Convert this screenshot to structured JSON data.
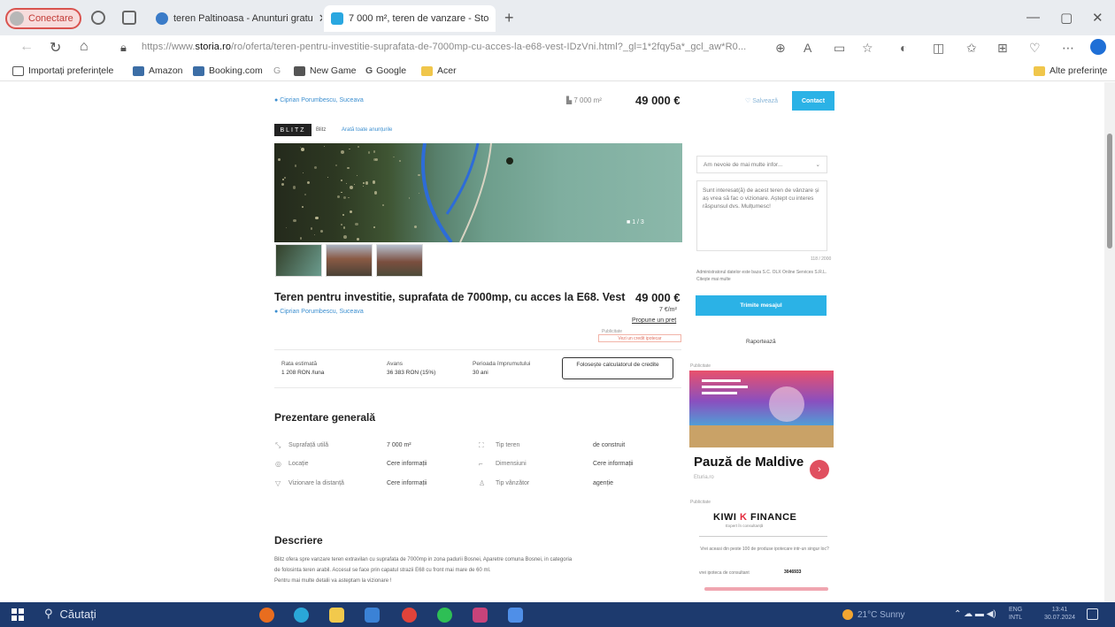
{
  "browser": {
    "profile_label": "Conectare",
    "tabs": [
      {
        "title": "teren Paltinoasa - Anunturi gratu",
        "active": false
      },
      {
        "title": "7 000 m², teren de vanzare - Sto",
        "active": true
      }
    ],
    "url_prefix": "https://www.",
    "url_domain": "storia.ro",
    "url_path": "/ro/oferta/teren-pentru-investitie-suprafata-de-7000mp-cu-acces-la-e68-vest-IDzVni.html?_gl=1*2fqy5a*_gcl_aw*R0...",
    "bookmarks": [
      "Importați preferințele",
      "Amazon",
      "Booking.com",
      "G",
      "New Game",
      "Google",
      "Acer"
    ],
    "other_bookmarks": "Alte preferințe"
  },
  "sticky": {
    "location": "Ciprian Porumbescu, Suceava",
    "area": "7 000 m²",
    "price": "49 000 €",
    "save": "Salvează",
    "contact": "Contact"
  },
  "agency": {
    "logo": "BLITZ",
    "name": "Blitz",
    "link": "Arată toate anunțurile"
  },
  "gallery": {
    "counter": "1 / 3"
  },
  "listing": {
    "title": "Teren pentru investitie, suprafata de 7000mp, cu acces la E68. Vest",
    "location": "Ciprian Porumbescu, Suceava",
    "price": "49 000 €",
    "price_per_m2": "7 €/m²",
    "propose": "Propune un preț",
    "publicity": "Publicitate",
    "developer_badge": "Vezi un credit ipotecar"
  },
  "credit": {
    "items": [
      {
        "label": "Rata estimată",
        "value": "1 208 RON /luna"
      },
      {
        "label": "Avans",
        "value": "36 383 RON (15%)"
      },
      {
        "label": "Perioada împrumutului",
        "value": "30 ani"
      }
    ],
    "calc_button": "Folosește calculatorul de credite"
  },
  "overview": {
    "title": "Prezentare generală",
    "rows": [
      {
        "label": "Suprafață utilă",
        "value": "7 000 m²",
        "label2": "Tip teren",
        "value2": "de construit"
      },
      {
        "label": "Locație",
        "value": "Cere informații",
        "label2": "Dimensiuni",
        "value2": "Cere informații"
      },
      {
        "label": "Vizionare la distanță",
        "value": "Cere informații",
        "label2": "Tip vânzător",
        "value2": "agenție"
      }
    ]
  },
  "description": {
    "title": "Descriere",
    "lines": [
      "Blitz ofera spre vanzare teren extravilan cu suprafata de 7000mp in zona padurii Bosnei, Aparetre comuna Bosnei, in categoria",
      "de folosinta teren arabil. Accesul se face prin capatul strazii E68 cu front mai mare de 60 ml.",
      "Pentru mai multe detalii va asteptam la vizionare !"
    ]
  },
  "contact_form": {
    "subject": "Am nevoie de mai multe infor...",
    "message": "Sunt interesat(ă) de acest teren de vânzare și aș vrea să fac o vizionare. Aștept cu interes răspunsul dvs. Mulțumesc!",
    "char_count": "118 / 2000",
    "consent": "Administratorul datelor este baza S.C. OLX Online Services S.R.L. Citește mai multe",
    "send_button": "Trimite mesajul",
    "report": "Raportează"
  },
  "ad1": {
    "label": "Publicitate",
    "title": "Pauză de Maldive",
    "subtitle": "Eturia.ro",
    "arrow": "›"
  },
  "ad2": {
    "label": "Publicitate",
    "logo_a": "KIWI ",
    "logo_k": "K",
    "logo_b": " FINANCE",
    "tag": "Expert în consultanță",
    "text": "Vrei aceasi din peste 100 de produse ipotecare intr-un singur loc?",
    "row": "vrei ipoteca de consultant",
    "number": "3046933"
  },
  "taskbar": {
    "search": "Căutați",
    "weather": "21°C Sunny",
    "lang": "ENG\nINTL",
    "time": "13:41",
    "date": "30.07.2024"
  }
}
